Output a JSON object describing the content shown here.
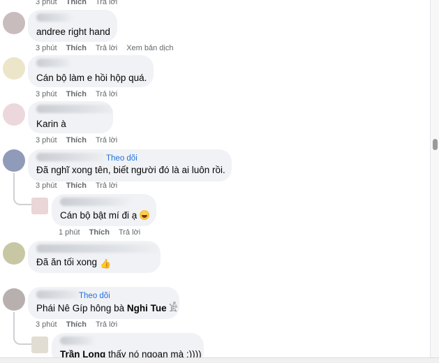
{
  "labels": {
    "like": "Thích",
    "reply": "Trả lời",
    "follow": "Theo dõi"
  },
  "top_actions": {
    "time": "3 phút"
  },
  "comments": [
    {
      "text": "andree right hand",
      "time": "3 phút",
      "translate": "Xem bản dịch",
      "avatar_color": "#c8bcbc"
    },
    {
      "text": "Cán bộ làm e hồi hộp quá.",
      "time": "3 phút",
      "avatar_color": "#ece5c9"
    },
    {
      "text": "Karin à",
      "time": "3 phút",
      "avatar_color": "#ecd8dc"
    },
    {
      "text": "Đã nghĩ xong tên, biết người đó là ai luôn rồi.",
      "time": "3 phút",
      "avatar_color": "#8f9bb8",
      "reply": {
        "text": "Cán bộ bật mí đi ạ",
        "emoji": "laughing-emoji",
        "time": "1 phút",
        "avatar_color": "#ead6d6"
      }
    },
    {
      "text": "Đã ăn tối xong",
      "emoji": "thumbs-up-emoji",
      "time": "3 phút",
      "avatar_color": "#c8c7a4"
    },
    {
      "text_prefix": "Phái Nê Gíp hông bà ",
      "text_bold": "Nghi Tue",
      "text_suffix": " 𓀀",
      "time": "3 phút",
      "avatar_color": "#b8b0ae",
      "reply": {
        "text_bold": "Trần Long",
        "text_suffix": " thấy nó ngoan mà :))))",
        "avatar_color": "#e2ddd2"
      }
    }
  ]
}
